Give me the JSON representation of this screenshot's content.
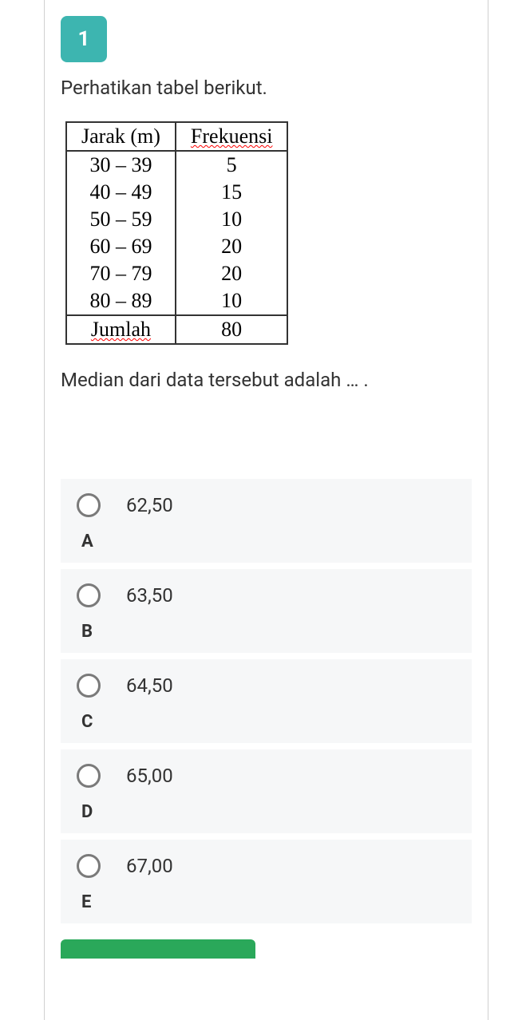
{
  "question_number": "1",
  "instruction": "Perhatikan tabel berikut.",
  "table": {
    "headers": {
      "col1": "Jarak (m)",
      "col2": "Frekuensi"
    },
    "rows": [
      {
        "range": "30 – 39",
        "freq": "5"
      },
      {
        "range": "40 – 49",
        "freq": "15"
      },
      {
        "range": "50 – 59",
        "freq": "10"
      },
      {
        "range": "60 – 69",
        "freq": "20"
      },
      {
        "range": "70 – 79",
        "freq": "20"
      },
      {
        "range": "80 – 89",
        "freq": "10"
      }
    ],
    "footer": {
      "label": "Jumlah",
      "value": "80"
    }
  },
  "question_text": "Median dari data tersebut adalah … .",
  "options": [
    {
      "letter": "A",
      "text": "62,50"
    },
    {
      "letter": "B",
      "text": "63,50"
    },
    {
      "letter": "C",
      "text": "64,50"
    },
    {
      "letter": "D",
      "text": "65,00"
    },
    {
      "letter": "E",
      "text": "67,00"
    }
  ],
  "chart_data": {
    "type": "table",
    "title": "Frequency distribution of Jarak (m)",
    "columns": [
      "Jarak (m)",
      "Frekuensi"
    ],
    "rows": [
      [
        "30 – 39",
        5
      ],
      [
        "40 – 49",
        15
      ],
      [
        "50 – 59",
        10
      ],
      [
        "60 – 69",
        20
      ],
      [
        "70 – 79",
        20
      ],
      [
        "80 – 89",
        10
      ]
    ],
    "totals": {
      "Frekuensi": 80
    }
  }
}
